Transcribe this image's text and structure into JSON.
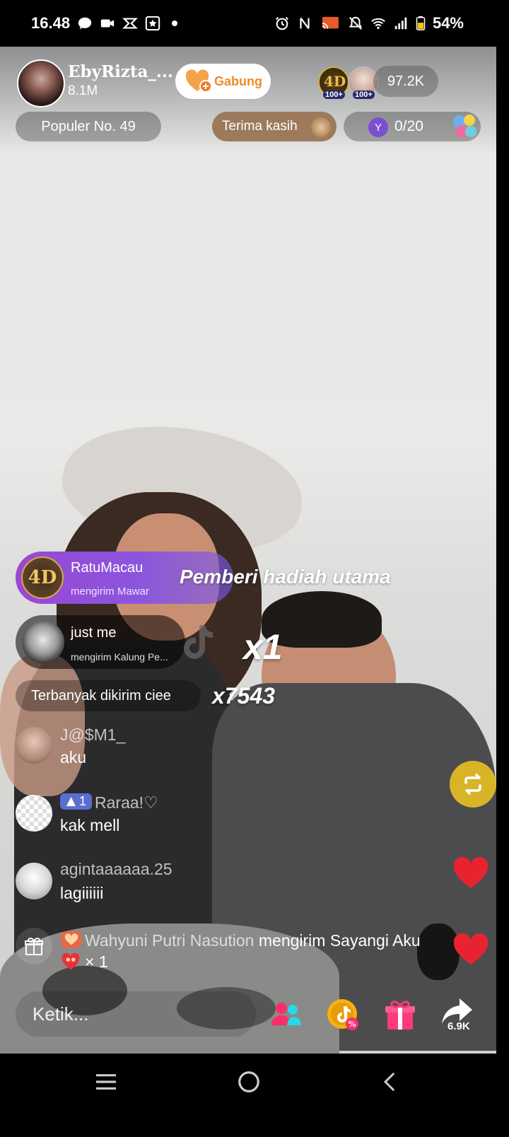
{
  "status_bar": {
    "time": "16.48",
    "battery": "54%"
  },
  "host": {
    "name": "EbyRizta_...",
    "followers": "8.1M",
    "join_label": "Gabung"
  },
  "viewers": {
    "badge_1": "100+",
    "badge_2": "100+",
    "count": "97.2K"
  },
  "popular_label": "Populer No. 49",
  "thanks_label": "Terima kasih",
  "goal": {
    "letter": "Y",
    "progress": "0/20",
    "current": 0,
    "target": 20
  },
  "gifts": [
    {
      "badge": "4D",
      "sender": "RatuMacau",
      "subtitle": "mengirim Mawar",
      "title": "Pemberi hadiah utama"
    },
    {
      "sender": "just me",
      "subtitle": "mengirim Kalung Pe...",
      "count": "x1"
    }
  ],
  "most_sent": {
    "label": "Terbanyak dikirim ciee",
    "count": "x7543"
  },
  "chat": [
    {
      "user": "J@$M1_",
      "text": "aku"
    },
    {
      "level": "1",
      "user": "Raraa!♡",
      "text": "kak mell"
    },
    {
      "user": "agintaaaaaa.25",
      "text": "lagiiiiii"
    }
  ],
  "gift_message": {
    "sender": "Wahyuni Putri Nasution",
    "action": "mengirim Sayangi Aku",
    "quantity": "× 1"
  },
  "bottom_bar": {
    "comment_placeholder": "Ketik...",
    "share_count": "6.9K"
  },
  "icons": {
    "status_left": [
      "message-icon",
      "video-camera-icon",
      "capcut-icon",
      "star-box-icon",
      "dot-icon"
    ],
    "status_right": [
      "alarm-icon",
      "nfc-icon",
      "cast-icon",
      "mute-icon",
      "wifi-icon",
      "signal-icon",
      "battery-icon"
    ],
    "bottom": [
      "people-icon",
      "tiktok-promo-icon",
      "gift-icon",
      "share-icon"
    ],
    "nav": [
      "recents-icon",
      "home-icon",
      "back-icon"
    ]
  },
  "colors": {
    "join_text": "#f08a2a",
    "gift_banner": "#9b47d4",
    "thanks_pill": "#9d7a5c",
    "heart": "#e8232f",
    "repost": "#f0c81e"
  }
}
